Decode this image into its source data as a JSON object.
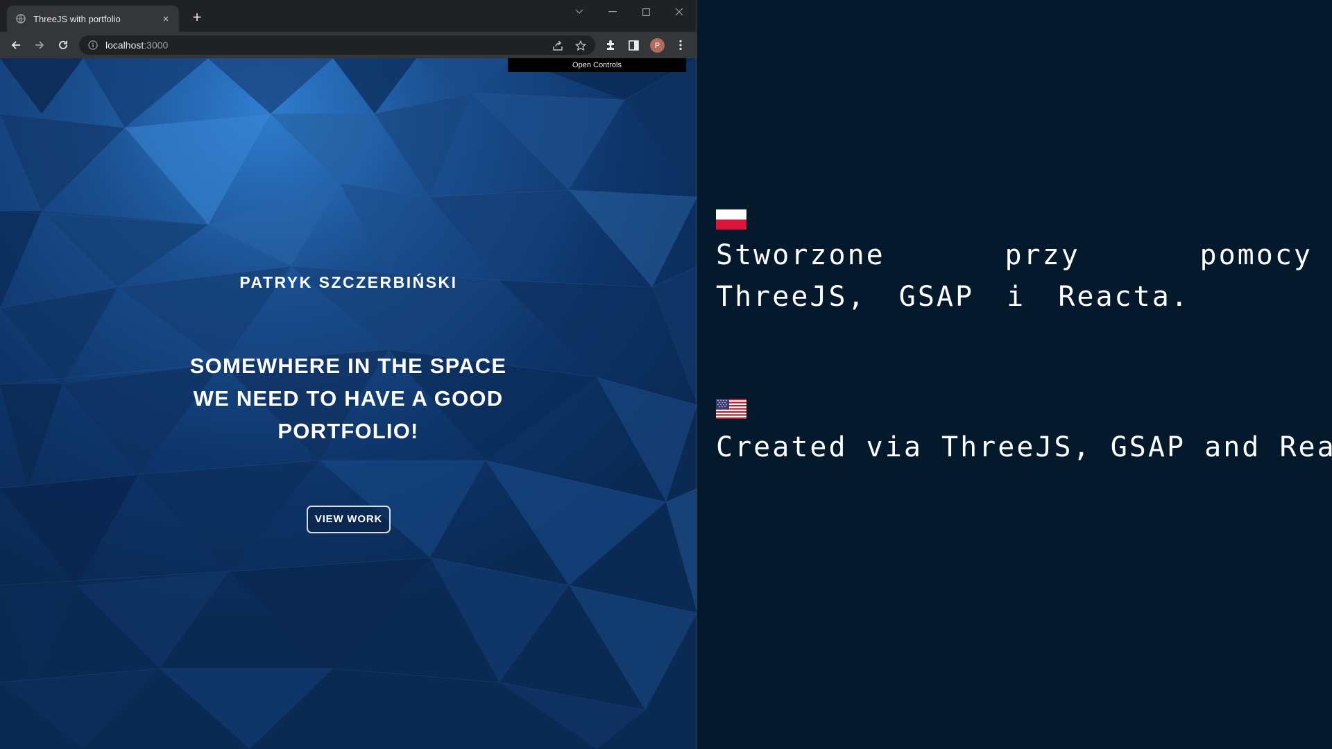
{
  "browser": {
    "tab": {
      "title": "ThreeJS with portfolio",
      "favicon": "globe-icon",
      "close": "×"
    },
    "new_tab": "+",
    "window_controls": [
      "chevron-down-icon",
      "minimize-icon",
      "maximize-icon",
      "close-icon"
    ],
    "address": {
      "host": "localhost",
      "port": ":3000"
    },
    "avatar_initial": "P"
  },
  "page": {
    "open_controls": "Open Controls",
    "name": "PATRYK SZCZERBIŃSKI",
    "headline": "SOMEWHERE IN THE SPACE WE NEED TO HAVE A GOOD PORTFOLIO!",
    "button": "VIEW WORK"
  },
  "right_panel": {
    "polish": {
      "flag": "poland-flag-icon",
      "text": "Stworzone przy pomocy ThreeJS, GSAP i Reacta."
    },
    "english": {
      "flag": "usa-flag-icon",
      "text": "Created via ThreeJS, GSAP and React."
    }
  },
  "colors": {
    "scene_base": "#0c2d57",
    "scene_highlight": "#2e78c8",
    "panel_bg": "#041a2c",
    "flag_red": "#dc143c"
  }
}
